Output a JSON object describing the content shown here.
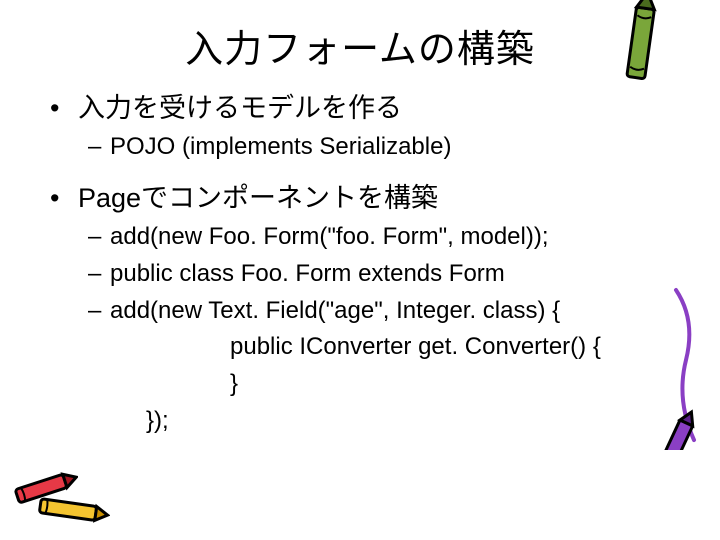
{
  "title": "入力フォームの構築",
  "bullets": {
    "b1": "入力を受けるモデルを作る",
    "b1_1": "POJO (implements Serializable)",
    "b2": "Pageでコンポーネントを構築",
    "b2_1": "add(new Foo. Form(\"foo. Form\", model));",
    "b2_2": "public class Foo. Form extends Form",
    "b2_3": "add(new Text. Field(\"age\", Integer. class) {",
    "code1": "public IConverter get. Converter() {",
    "code2": "}",
    "code3": "});"
  }
}
